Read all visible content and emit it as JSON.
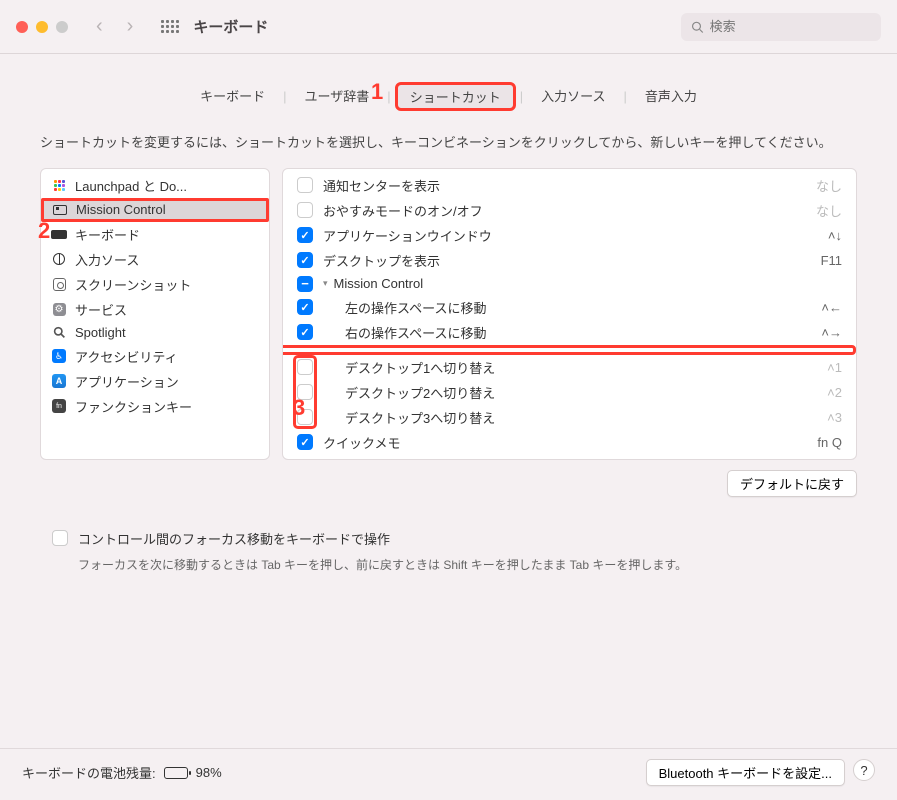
{
  "window": {
    "title": "キーボード"
  },
  "search": {
    "placeholder": "検索"
  },
  "tabs": {
    "items": [
      "キーボード",
      "ユーザ辞書",
      "ショートカット",
      "入力ソース",
      "音声入力"
    ],
    "active_index": 2
  },
  "instruction": "ショートカットを変更するには、ショートカットを選択し、キーコンビネーションをクリックしてから、新しいキーを押してください。",
  "categories": [
    {
      "label": "Launchpad と Do...",
      "icon": "launchpad"
    },
    {
      "label": "Mission Control",
      "icon": "mission",
      "selected": true
    },
    {
      "label": "キーボード",
      "icon": "keyboard"
    },
    {
      "label": "入力ソース",
      "icon": "globe"
    },
    {
      "label": "スクリーンショット",
      "icon": "screenshot"
    },
    {
      "label": "サービス",
      "icon": "services"
    },
    {
      "label": "Spotlight",
      "icon": "spotlight"
    },
    {
      "label": "アクセシビリティ",
      "icon": "access"
    },
    {
      "label": "アプリケーション",
      "icon": "app"
    },
    {
      "label": "ファンクションキー",
      "icon": "fn"
    }
  ],
  "shortcuts": [
    {
      "label": "通知センターを表示",
      "checked": false,
      "key": "なし",
      "dim": true
    },
    {
      "label": "おやすみモードのオン/オフ",
      "checked": false,
      "key": "なし",
      "dim": true
    },
    {
      "label": "アプリケーションウインドウ",
      "checked": true,
      "key": "˄↓"
    },
    {
      "label": "デスクトップを表示",
      "checked": true,
      "key": "F11"
    },
    {
      "label": "Mission Control",
      "state": "minus",
      "disclosure": true
    },
    {
      "label": "左の操作スペースに移動",
      "checked": true,
      "key": "˄←",
      "indent": 1
    },
    {
      "label": "右の操作スペースに移動",
      "checked": true,
      "key": "˄→",
      "indent": 1
    },
    {
      "label": "デスクトップ1へ切り替え",
      "checked": false,
      "key": "˄1",
      "dim": true,
      "indent": 1,
      "boxed": true
    },
    {
      "label": "デスクトップ2へ切り替え",
      "checked": false,
      "key": "˄2",
      "dim": true,
      "indent": 1,
      "boxed": true
    },
    {
      "label": "デスクトップ3へ切り替え",
      "checked": false,
      "key": "˄3",
      "dim": true,
      "indent": 1,
      "boxed": true
    },
    {
      "label": "クイックメモ",
      "checked": true,
      "key": "fn Q"
    }
  ],
  "restore_button": "デフォルトに戻す",
  "focus": {
    "label": "コントロール間のフォーカス移動をキーボードで操作",
    "desc": "フォーカスを次に移動するときは Tab キーを押し、前に戻すときは Shift キーを押したまま Tab キーを押します。"
  },
  "footer": {
    "battery_label": "キーボードの電池残量:",
    "battery_pct": "98%",
    "bluetooth_btn": "Bluetooth キーボードを設定..."
  },
  "annotations": {
    "a1": "1",
    "a2": "2",
    "a3": "3"
  }
}
